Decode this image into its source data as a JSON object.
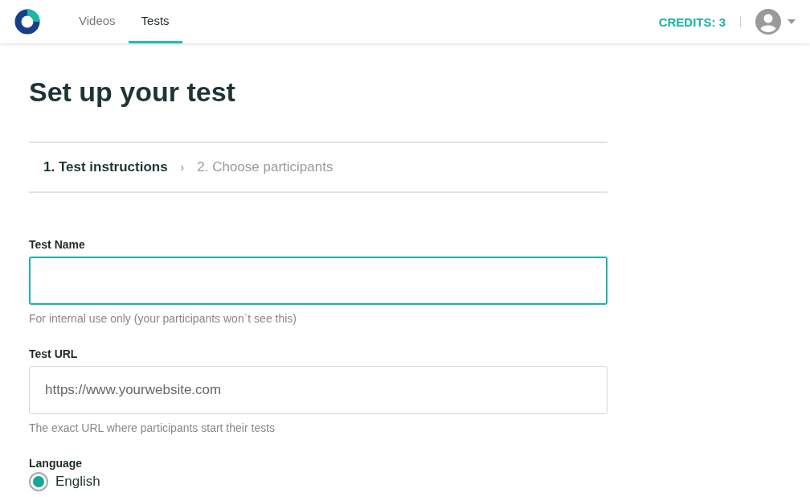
{
  "nav": {
    "tabs": [
      {
        "label": "Videos",
        "selected": false
      },
      {
        "label": "Tests",
        "selected": true
      }
    ],
    "credits": "CREDITS: 3"
  },
  "title": "Set up your test",
  "steps": [
    {
      "label": "1. Test instructions",
      "selected": true
    },
    {
      "label": "2. Choose participants",
      "selected": false
    }
  ],
  "step_separator": "›",
  "fields": [
    {
      "label": "Test Name",
      "focused": true,
      "help": "For internal use only (your participants won`t see this)"
    },
    {
      "label": "Test URL",
      "focused": false,
      "placeholder": "https://www.yourwebsite.com",
      "help": "The exact URL where participants start their tests"
    }
  ],
  "language": {
    "label": "Language",
    "options": [
      {
        "label": "English",
        "selected": true
      }
    ]
  }
}
